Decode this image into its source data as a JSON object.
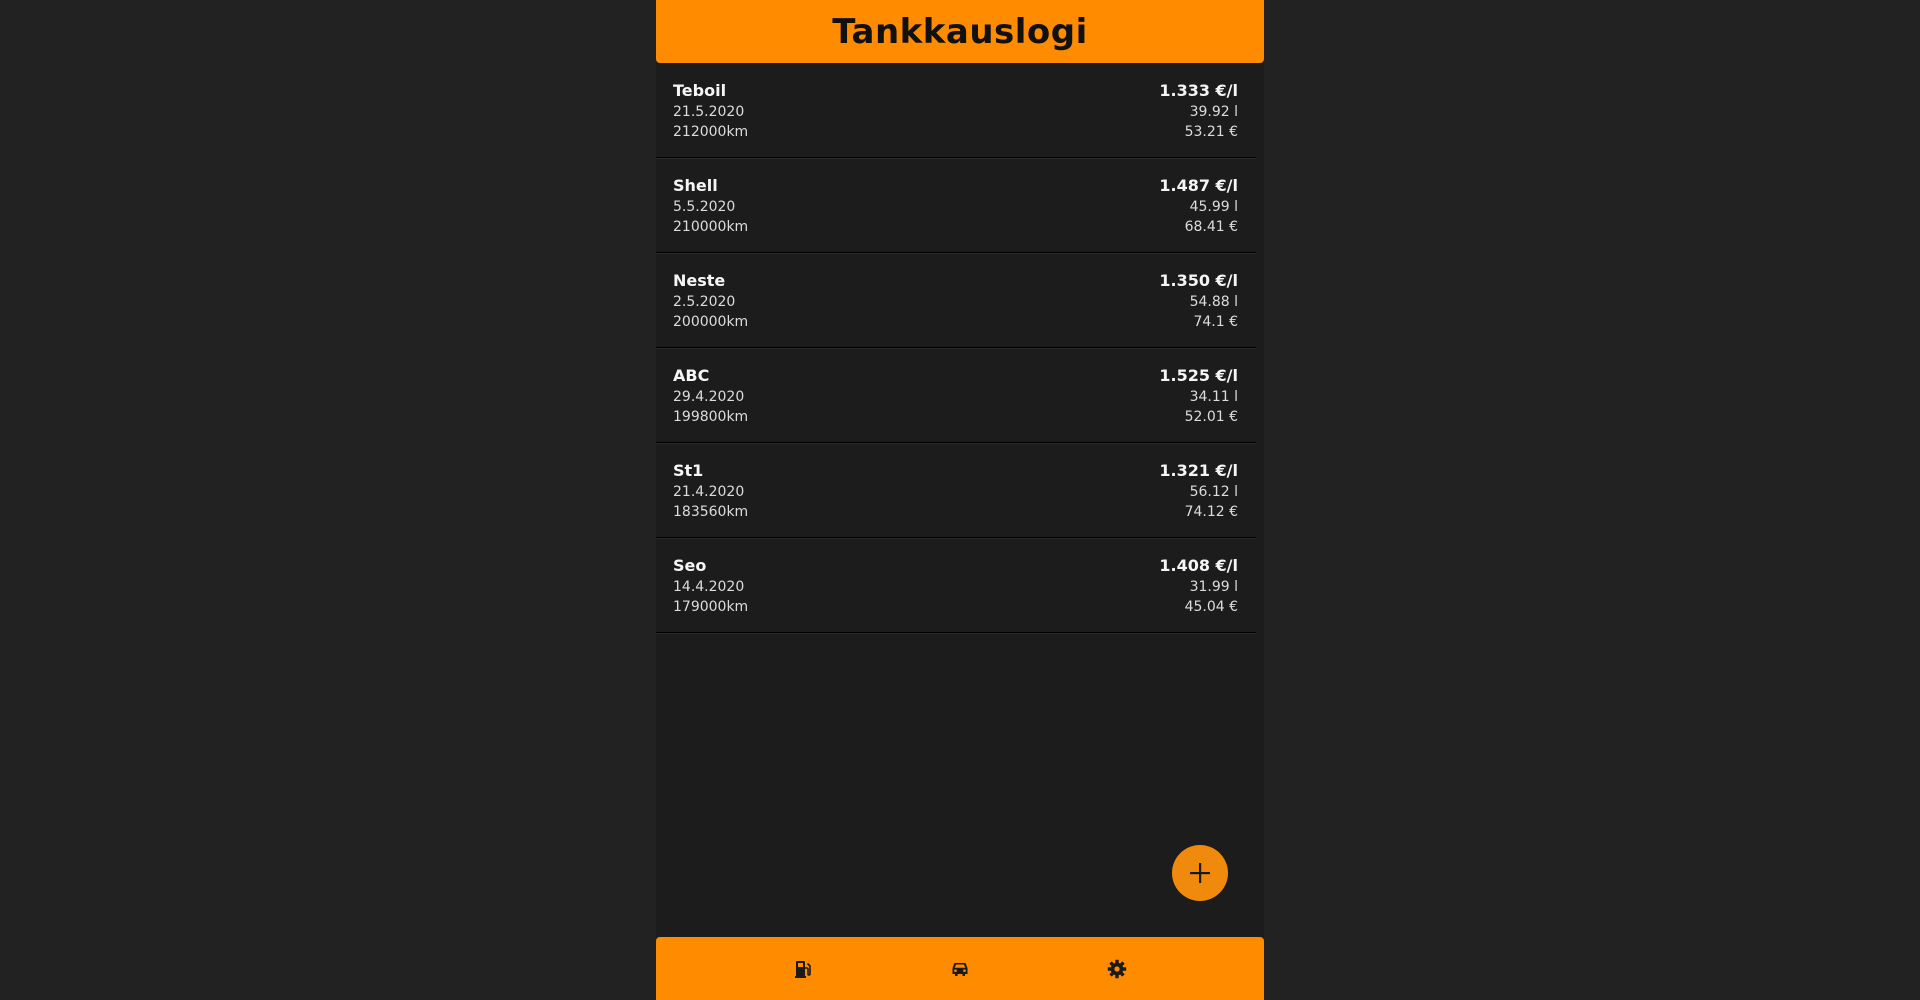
{
  "header": {
    "title": "Tankkauslogi"
  },
  "entries": [
    {
      "station": "Teboil",
      "date": "21.5.2020",
      "odometer": "212000km",
      "price_per_liter": "1.333 €/l",
      "liters": "39.92 l",
      "total": "53.21 €"
    },
    {
      "station": "Shell",
      "date": "5.5.2020",
      "odometer": "210000km",
      "price_per_liter": "1.487 €/l",
      "liters": "45.99 l",
      "total": "68.41 €"
    },
    {
      "station": "Neste",
      "date": "2.5.2020",
      "odometer": "200000km",
      "price_per_liter": "1.350 €/l",
      "liters": "54.88 l",
      "total": "74.1 €"
    },
    {
      "station": "ABC",
      "date": "29.4.2020",
      "odometer": "199800km",
      "price_per_liter": "1.525 €/l",
      "liters": "34.11 l",
      "total": "52.01 €"
    },
    {
      "station": "St1",
      "date": "21.4.2020",
      "odometer": "183560km",
      "price_per_liter": "1.321 €/l",
      "liters": "56.12 l",
      "total": "74.12 €"
    },
    {
      "station": "Seo",
      "date": "14.4.2020",
      "odometer": "179000km",
      "price_per_liter": "1.408 €/l",
      "liters": "31.99 l",
      "total": "45.04 €"
    }
  ],
  "fab": {
    "icon": "plus-icon"
  },
  "bottom_nav": {
    "items": [
      {
        "icon": "gas-pump-icon"
      },
      {
        "icon": "car-icon"
      },
      {
        "icon": "gear-icon"
      }
    ]
  },
  "colors": {
    "accent": "#ff8c00",
    "fab": "#f08a0c",
    "page_background": "#222222",
    "app_background": "#1c1c1c"
  }
}
